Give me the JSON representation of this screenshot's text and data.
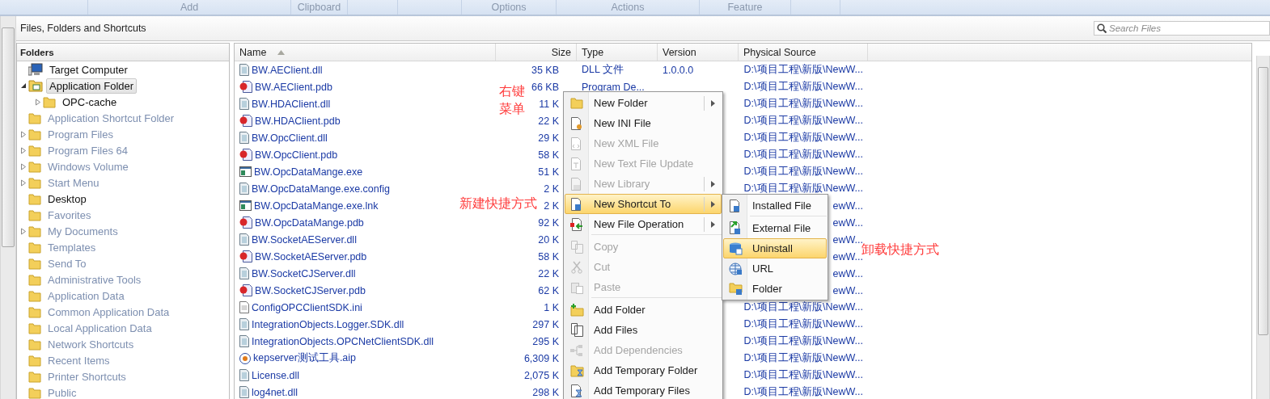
{
  "ribbon": {
    "groups": [
      "Add",
      "Clipboard",
      "Options",
      "Actions",
      "Feature"
    ]
  },
  "panel": {
    "title": "Files, Folders and Shortcuts",
    "search": {
      "placeholder": "Search Files"
    }
  },
  "folders": {
    "header": "Folders",
    "tree": [
      {
        "label": "Target Computer",
        "kind": "computer",
        "dimmed": false,
        "selected": false,
        "children": [
          {
            "label": "Application Folder",
            "kind": "app",
            "dimmed": false,
            "selected": true,
            "expanded": true,
            "children": [
              {
                "label": "OPC-cache",
                "kind": "folder",
                "dimmed": false,
                "selected": false,
                "expanded": false
              }
            ]
          },
          {
            "label": "Application Shortcut Folder",
            "kind": "folder",
            "dimmed": true,
            "selected": false
          },
          {
            "label": "Program Files",
            "kind": "folder",
            "dimmed": true,
            "selected": false,
            "expanded": false
          },
          {
            "label": "Program Files 64",
            "kind": "folder",
            "dimmed": true,
            "selected": false,
            "expanded": false
          },
          {
            "label": "Windows Volume",
            "kind": "folder",
            "dimmed": true,
            "selected": false,
            "expanded": false
          },
          {
            "label": "Start Menu",
            "kind": "folder",
            "dimmed": true,
            "selected": false,
            "expanded": false
          },
          {
            "label": "Desktop",
            "kind": "folder",
            "dimmed": false,
            "selected": false
          },
          {
            "label": "Favorites",
            "kind": "folder",
            "dimmed": true,
            "selected": false
          },
          {
            "label": "My Documents",
            "kind": "folder",
            "dimmed": true,
            "selected": false,
            "expanded": false
          },
          {
            "label": "Templates",
            "kind": "folder",
            "dimmed": true,
            "selected": false
          },
          {
            "label": "Send To",
            "kind": "folder",
            "dimmed": true,
            "selected": false
          },
          {
            "label": "Administrative Tools",
            "kind": "folder",
            "dimmed": true,
            "selected": false
          },
          {
            "label": "Application Data",
            "kind": "folder",
            "dimmed": true,
            "selected": false
          },
          {
            "label": "Common Application Data",
            "kind": "folder",
            "dimmed": true,
            "selected": false
          },
          {
            "label": "Local Application Data",
            "kind": "folder",
            "dimmed": true,
            "selected": false
          },
          {
            "label": "Network Shortcuts",
            "kind": "folder",
            "dimmed": true,
            "selected": false
          },
          {
            "label": "Recent Items",
            "kind": "folder",
            "dimmed": true,
            "selected": false
          },
          {
            "label": "Printer Shortcuts",
            "kind": "folder",
            "dimmed": true,
            "selected": false
          },
          {
            "label": "Public",
            "kind": "folder",
            "dimmed": true,
            "selected": false
          }
        ]
      }
    ]
  },
  "files": {
    "columns": [
      "Name",
      "Size",
      "Type",
      "Version",
      "Physical Source"
    ],
    "rows": [
      {
        "kind": "dll",
        "name": "BW.AEClient.dll",
        "size": "35 KB",
        "type": "DLL 文件",
        "version": "1.0.0.0",
        "source": "D:\\项目工程\\新版\\NewW..."
      },
      {
        "kind": "pdb",
        "name": "BW.AEClient.pdb",
        "size": "66 KB",
        "type": "Program De...",
        "source": "D:\\项目工程\\新版\\NewW..."
      },
      {
        "kind": "dll",
        "name": "BW.HDAClient.dll",
        "size": "11 K",
        "source": "D:\\项目工程\\新版\\NewW..."
      },
      {
        "kind": "pdb",
        "name": "BW.HDAClient.pdb",
        "size": "22 K",
        "source": "D:\\项目工程\\新版\\NewW..."
      },
      {
        "kind": "dll",
        "name": "BW.OpcClient.dll",
        "size": "29 K",
        "source": "D:\\项目工程\\新版\\NewW..."
      },
      {
        "kind": "pdb",
        "name": "BW.OpcClient.pdb",
        "size": "58 K",
        "source": "D:\\项目工程\\新版\\NewW..."
      },
      {
        "kind": "exe",
        "name": "BW.OpcDataMange.exe",
        "size": "51 K",
        "source": "D:\\项目工程\\新版\\NewW..."
      },
      {
        "kind": "dll",
        "name": "BW.OpcDataMange.exe.config",
        "size": "2 K",
        "source": "D:\\项目工程\\新版\\NewW..."
      },
      {
        "kind": "exe",
        "name": "BW.OpcDataMange.exe.lnk",
        "size": "2 K",
        "source": "ewW..."
      },
      {
        "kind": "pdb",
        "name": "BW.OpcDataMange.pdb",
        "size": "92 K",
        "source": "ewW..."
      },
      {
        "kind": "dll",
        "name": "BW.SocketAEServer.dll",
        "size": "20 K",
        "source": "ewW..."
      },
      {
        "kind": "pdb",
        "name": "BW.SocketAEServer.pdb",
        "size": "58 K",
        "source": "ewW..."
      },
      {
        "kind": "dll",
        "name": "BW.SocketCJServer.dll",
        "size": "22 K",
        "source": "ewW..."
      },
      {
        "kind": "pdb",
        "name": "BW.SocketCJServer.pdb",
        "size": "62 K",
        "source": "ewW..."
      },
      {
        "kind": "ini",
        "name": "ConfigOPCClientSDK.ini",
        "size": "1 K",
        "source": "D:\\项目工程\\新版\\NewW..."
      },
      {
        "kind": "dll",
        "name": "IntegrationObjects.Logger.SDK.dll",
        "size": "297 K",
        "source": "D:\\项目工程\\新版\\NewW..."
      },
      {
        "kind": "dll",
        "name": "IntegrationObjects.OPCNetClientSDK.dll",
        "size": "295 K",
        "source": "D:\\项目工程\\新版\\NewW..."
      },
      {
        "kind": "aip",
        "name": "kepserver测试工具.aip",
        "size": "6,309 K",
        "source": "D:\\项目工程\\新版\\NewW..."
      },
      {
        "kind": "dll",
        "name": "License.dll",
        "size": "2,075 K",
        "source": "D:\\项目工程\\新版\\NewW..."
      },
      {
        "kind": "dll",
        "name": "log4net.dll",
        "size": "298 K",
        "source": "D:\\项目工程\\新版\\NewW..."
      }
    ]
  },
  "context_menu": {
    "sections": [
      [
        {
          "label": "New Folder",
          "disabled": false,
          "selected": false,
          "submenu": true
        },
        {
          "label": "New INI File",
          "disabled": false,
          "selected": false,
          "submenu": false
        },
        {
          "label": "New XML File",
          "disabled": true,
          "selected": false,
          "submenu": false
        },
        {
          "label": "New Text File Update",
          "disabled": true,
          "selected": false,
          "submenu": false
        },
        {
          "label": "New Library",
          "disabled": true,
          "selected": false,
          "submenu": true
        },
        {
          "label": "New Shortcut To",
          "disabled": false,
          "selected": true,
          "submenu": true
        },
        {
          "label": "New File Operation",
          "disabled": false,
          "selected": false,
          "submenu": true
        }
      ],
      [
        {
          "label": "Copy",
          "disabled": true,
          "selected": false,
          "submenu": false
        },
        {
          "label": "Cut",
          "disabled": true,
          "selected": false,
          "submenu": false
        },
        {
          "label": "Paste",
          "disabled": true,
          "selected": false,
          "submenu": false
        }
      ],
      [
        {
          "label": "Add Folder",
          "disabled": false,
          "selected": false,
          "submenu": false
        },
        {
          "label": "Add Files",
          "disabled": false,
          "selected": false,
          "submenu": false
        },
        {
          "label": "Add Dependencies",
          "disabled": true,
          "selected": false,
          "submenu": false
        },
        {
          "label": "Add Temporary Folder",
          "disabled": false,
          "selected": false,
          "submenu": false
        },
        {
          "label": "Add Temporary Files",
          "disabled": false,
          "selected": false,
          "submenu": false
        }
      ]
    ]
  },
  "submenu": {
    "sections": [
      [
        {
          "label": "Installed File",
          "selected": false
        }
      ],
      [
        {
          "label": "External File",
          "selected": false
        },
        {
          "label": "Uninstall",
          "selected": true
        },
        {
          "label": "URL",
          "selected": false
        },
        {
          "label": "Folder",
          "selected": false
        }
      ]
    ]
  },
  "annotations": [
    "右键菜单",
    "新建快捷方式",
    "卸载快捷方式"
  ]
}
